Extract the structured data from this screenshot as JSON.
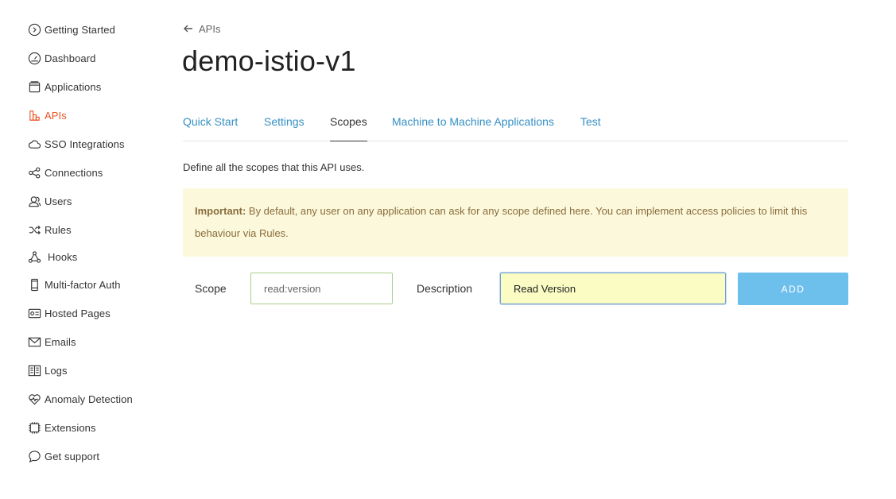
{
  "sidebar": {
    "items": [
      {
        "label": "Getting Started",
        "icon": "play-circle-icon"
      },
      {
        "label": "Dashboard",
        "icon": "gauge-icon"
      },
      {
        "label": "Applications",
        "icon": "window-icon"
      },
      {
        "label": "APIs",
        "icon": "api-blocks-icon",
        "active": true
      },
      {
        "label": "SSO Integrations",
        "icon": "cloud-icon"
      },
      {
        "label": "Connections",
        "icon": "share-icon"
      },
      {
        "label": "Users",
        "icon": "users-icon"
      },
      {
        "label": "Rules",
        "icon": "shuffle-icon"
      },
      {
        "label": "Hooks",
        "icon": "hooks-icon"
      },
      {
        "label": "Multi-factor Auth",
        "icon": "phone-icon"
      },
      {
        "label": "Hosted Pages",
        "icon": "hosted-pages-icon"
      },
      {
        "label": "Emails",
        "icon": "envelope-icon"
      },
      {
        "label": "Logs",
        "icon": "book-icon"
      },
      {
        "label": "Anomaly Detection",
        "icon": "heart-pulse-icon"
      },
      {
        "label": "Extensions",
        "icon": "chip-icon"
      },
      {
        "label": "Get support",
        "icon": "chat-bubble-icon"
      }
    ],
    "active_color": "#eb5424"
  },
  "breadcrumb": {
    "back_label": "APIs"
  },
  "page": {
    "title": "demo-istio-v1"
  },
  "tabs": [
    {
      "label": "Quick Start"
    },
    {
      "label": "Settings"
    },
    {
      "label": "Scopes",
      "active": true
    },
    {
      "label": "Machine to Machine Applications"
    },
    {
      "label": "Test"
    }
  ],
  "scopes": {
    "intro": "Define all the scopes that this API uses.",
    "alert": {
      "strong": "Important:",
      "text": " By default, any user on any application can ask for any scope defined here. You can implement access policies to limit this behaviour via Rules."
    },
    "form": {
      "scope_label": "Scope",
      "scope_value": "read:version",
      "description_label": "Description",
      "description_value": "Read Version",
      "add_label": "ADD"
    }
  },
  "colors": {
    "link": "#3690c4",
    "alert_bg": "#fcf8dc",
    "button": "#6ec0ec"
  }
}
